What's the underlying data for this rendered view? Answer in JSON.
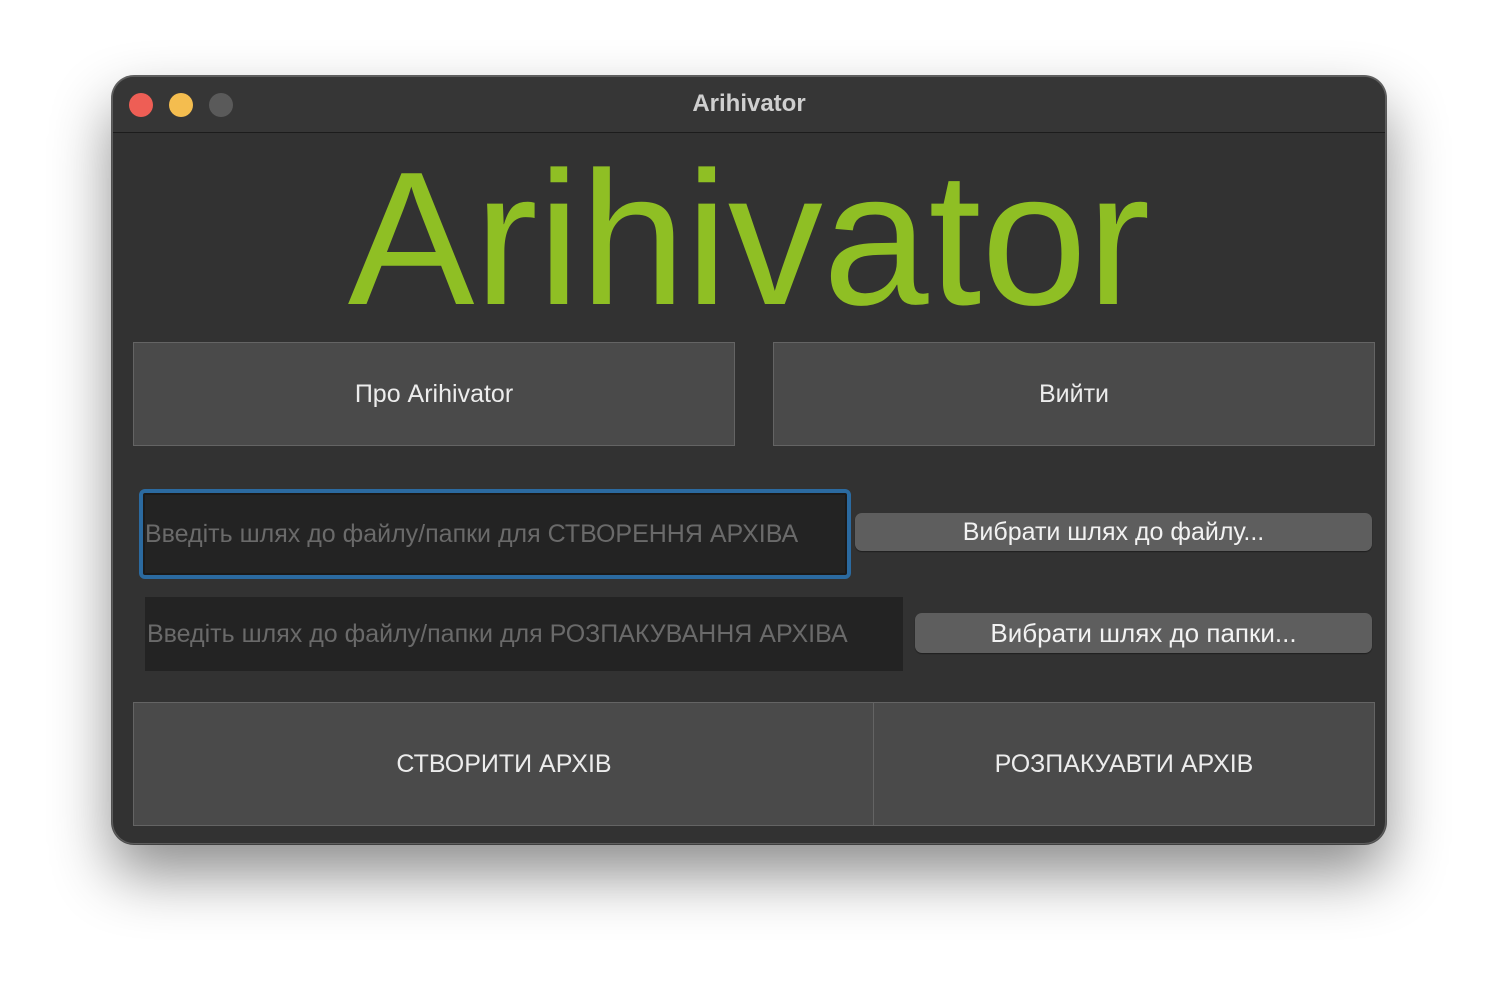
{
  "window": {
    "title": "Arihivator"
  },
  "app": {
    "heading": "Arihivator"
  },
  "buttons": {
    "about": "Про Arihivator",
    "exit": "Вийти",
    "choose_file": "Вибрати шлях до файлу...",
    "choose_folder": "Вибрати шлях до папки...",
    "create": "СТВОРИТИ АРХІВ",
    "unpack": "РОЗПАКУАВТИ АРХІВ"
  },
  "inputs": {
    "create_path": {
      "value": "",
      "placeholder": "Введіть шлях до файлу/папки для СТВОРЕННЯ АРХІВА"
    },
    "unpack_path": {
      "value": "",
      "placeholder": "Введіть шлях до файлу/папки для РОЗПАКУВАННЯ АРХІВА"
    }
  },
  "colors": {
    "accent_green": "#8fbf24",
    "focus_blue": "#2b6aa0",
    "background": "#323232"
  }
}
